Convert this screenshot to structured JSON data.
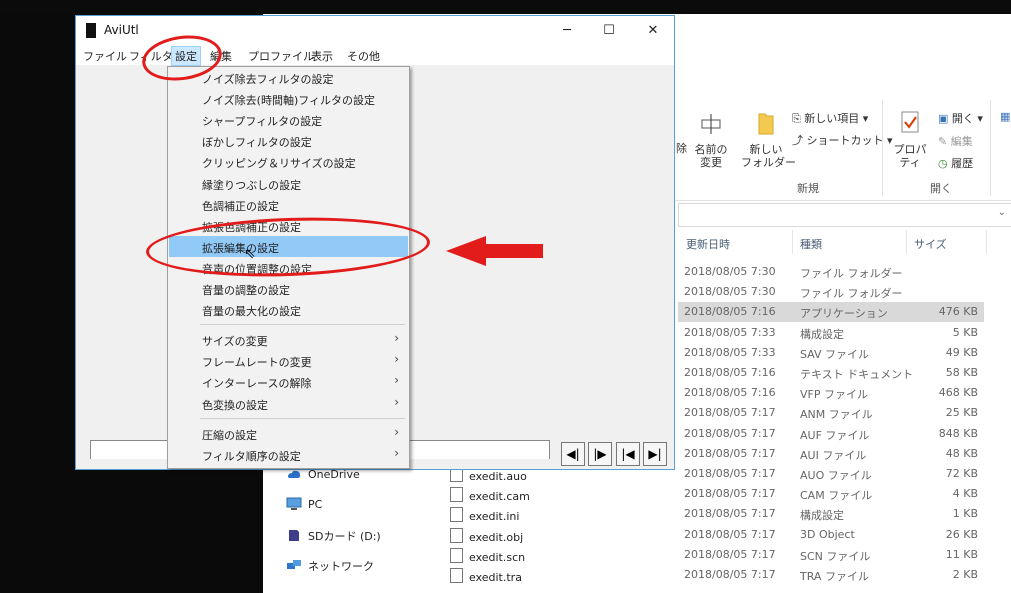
{
  "aviutl": {
    "title": "AviUtl",
    "window_buttons": {
      "minimize": "─",
      "maximize": "☐",
      "close": "✕"
    },
    "menubar": [
      "ファイル",
      "フィルタ",
      "設定",
      "編集",
      "プロファイル",
      "表示",
      "その他"
    ],
    "settings_menu": {
      "group1": [
        "ノイズ除去フィルタの設定",
        "ノイズ除去(時間軸)フィルタの設定",
        "シャープフィルタの設定",
        "ぼかしフィルタの設定",
        "クリッピング＆リサイズの設定",
        "縁塗りつぶしの設定",
        "色調補正の設定",
        "拡張色調補正の設定",
        "拡張編集の設定",
        "音声の位置調整の設定",
        "音量の調整の設定",
        "音量の最大化の設定"
      ],
      "highlighted": "拡張編集の設定",
      "group2": [
        "サイズの変更",
        "フレームレートの変更",
        "インターレースの解除",
        "色変換の設定"
      ],
      "group3": [
        "圧縮の設定",
        "フィルタ順序の設定"
      ]
    },
    "nav_buttons": [
      "◀|",
      "|▶",
      "|◀",
      "▶|"
    ]
  },
  "explorer": {
    "ribbon": {
      "rename_label": "名前の\n変更",
      "new_folder_label": "新しい\nフォルダー",
      "new_item": "新しい項目 ▾",
      "shortcut": "ショートカット ▾",
      "group_new": "新規",
      "properties": "プロパティ",
      "open": "開く ▾",
      "edit": "編集",
      "history": "履歴",
      "group_open": "開く",
      "partial_left": "除"
    },
    "columns": {
      "date": "更新日時",
      "type": "種類",
      "size": "サイズ"
    },
    "nav": [
      {
        "icon": "onedrive-icon",
        "label": "OneDrive"
      },
      {
        "icon": "pc-icon",
        "label": "PC"
      },
      {
        "icon": "sd-card-icon",
        "label": "SDカード (D:)"
      },
      {
        "icon": "network-icon",
        "label": "ネットワーク"
      }
    ],
    "rows": [
      {
        "name": "",
        "date": "2018/08/05 7:30",
        "type": "ファイル フォルダー",
        "size": ""
      },
      {
        "name": "",
        "date": "2018/08/05 7:30",
        "type": "ファイル フォルダー",
        "size": ""
      },
      {
        "name": "",
        "date": "2018/08/05 7:16",
        "type": "アプリケーション",
        "size": "476 KB"
      },
      {
        "name": "",
        "date": "2018/08/05 7:33",
        "type": "構成設定",
        "size": "5 KB"
      },
      {
        "name": "",
        "date": "2018/08/05 7:33",
        "type": "SAV ファイル",
        "size": "49 KB"
      },
      {
        "name": "",
        "date": "2018/08/05 7:16",
        "type": "テキスト ドキュメント",
        "size": "58 KB"
      },
      {
        "name": "",
        "date": "2018/08/05 7:16",
        "type": "VFP ファイル",
        "size": "468 KB"
      },
      {
        "name": "",
        "date": "2018/08/05 7:17",
        "type": "ANM ファイル",
        "size": "25 KB"
      },
      {
        "name": "",
        "date": "2018/08/05 7:17",
        "type": "AUF ファイル",
        "size": "848 KB"
      },
      {
        "name": "",
        "date": "2018/08/05 7:17",
        "type": "AUI ファイル",
        "size": "48 KB"
      },
      {
        "name": "exedit.auo",
        "date": "2018/08/05 7:17",
        "type": "AUO ファイル",
        "size": "72 KB"
      },
      {
        "name": "exedit.cam",
        "date": "2018/08/05 7:17",
        "type": "CAM ファイル",
        "size": "4 KB"
      },
      {
        "name": "exedit.ini",
        "date": "2018/08/05 7:17",
        "type": "構成設定",
        "size": "1 KB"
      },
      {
        "name": "exedit.obj",
        "date": "2018/08/05 7:17",
        "type": "3D Object",
        "size": "26 KB"
      },
      {
        "name": "exedit.scn",
        "date": "2018/08/05 7:17",
        "type": "SCN ファイル",
        "size": "11 KB"
      },
      {
        "name": "exedit.tra",
        "date": "2018/08/05 7:17",
        "type": "TRA ファイル",
        "size": "2 KB"
      }
    ]
  },
  "annotation_color": "#e21b1b"
}
